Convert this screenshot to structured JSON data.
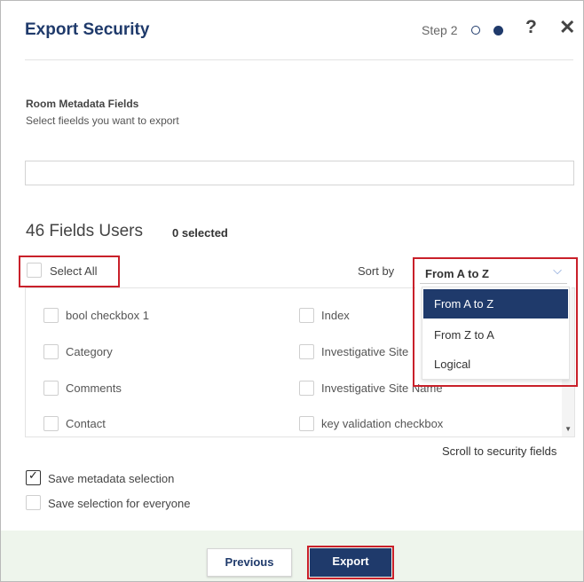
{
  "dialog": {
    "title": "Export Security",
    "step_label": "Step 2",
    "help_glyph": "?",
    "close_glyph": "✕",
    "accent_color": "#1f3a6b",
    "highlight_color": "#c9202a"
  },
  "metadata": {
    "section_title": "Room Metadata Fields",
    "section_subtitle": "Select fieelds you want to export",
    "search_value": ""
  },
  "fields": {
    "count_label": "46 Fields Users",
    "selected_label": "0 selected",
    "select_all_label": "Select All",
    "sort_label": "Sort by",
    "sort_selected": "From A to Z",
    "sort_options": [
      "From A to Z",
      "From Z to A",
      "Logical"
    ],
    "items_left": [
      "bool checkbox 1",
      "Category",
      "Comments",
      "Contact"
    ],
    "items_right": [
      "Index",
      "Investigative Site",
      "Investigative Site Name",
      "key validation checkbox"
    ],
    "scroll_link": "Scroll to security fields"
  },
  "options": {
    "save_metadata_label": "Save metadata selection",
    "save_metadata_checked": true,
    "save_everyone_label": "Save selection for everyone",
    "save_everyone_checked": false
  },
  "footer": {
    "previous_label": "Previous",
    "export_label": "Export"
  }
}
